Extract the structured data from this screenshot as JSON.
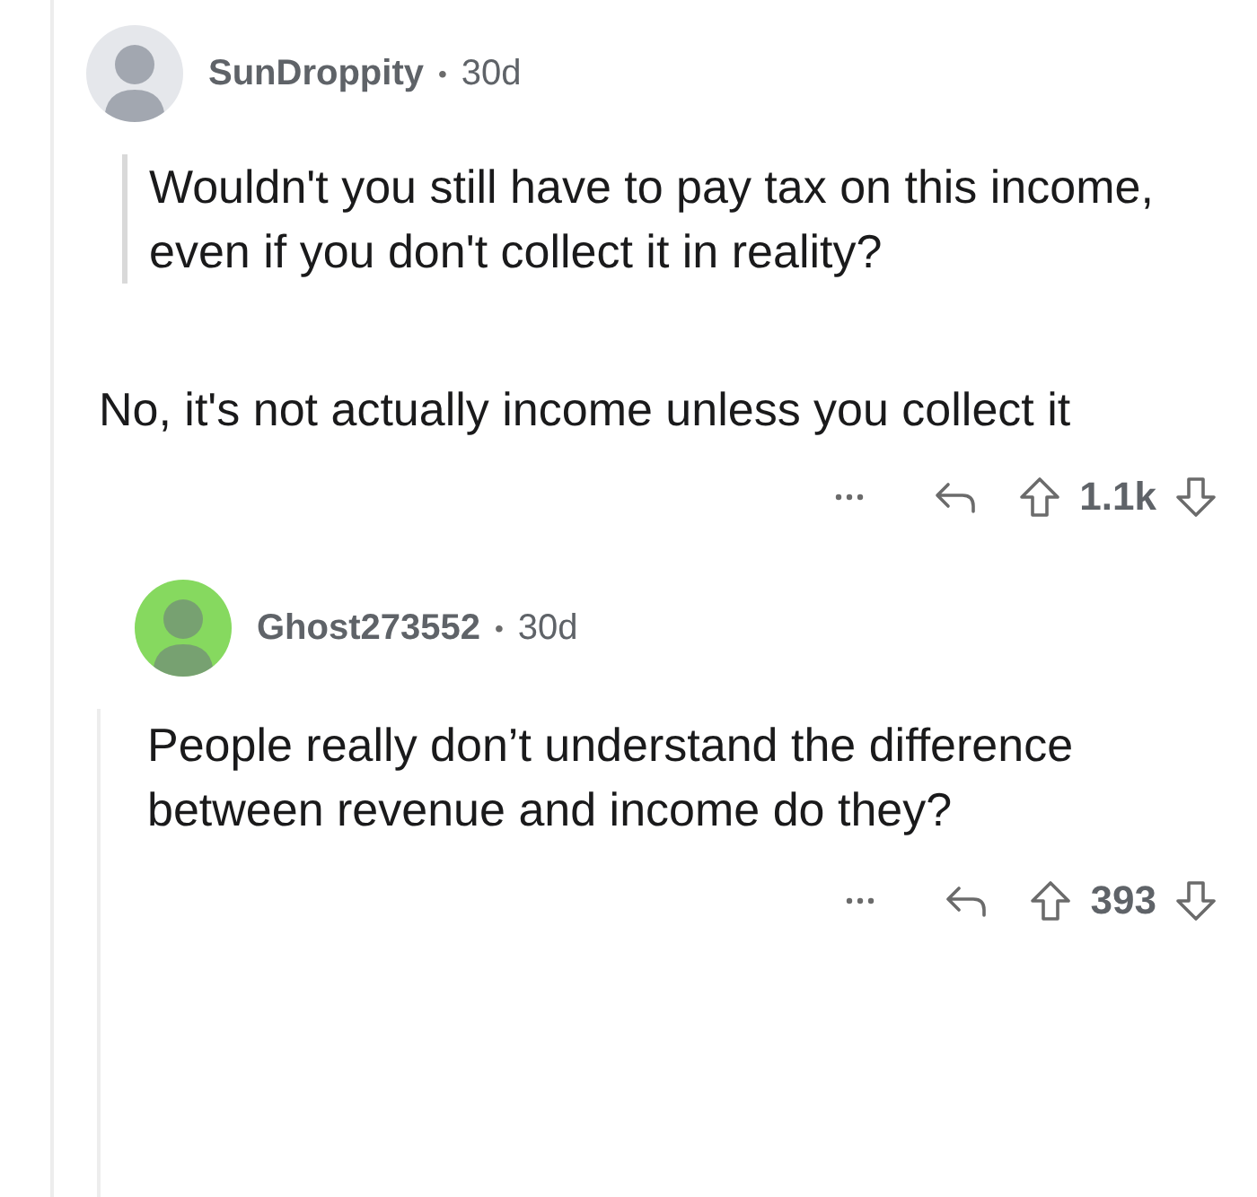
{
  "comments": [
    {
      "author": "SunDroppity",
      "separator": "•",
      "age": "30d",
      "color": "#e5e7eb",
      "quote": "Wouldn't you still have to pay tax on this income, even if you don't collect it in reality?",
      "body": "No, it's not actually income unless you collect it",
      "score": "1.1k",
      "children": [
        {
          "author": "Ghost273552",
          "separator": "•",
          "age": "30d",
          "color": "#86d95f",
          "body": "People really don’t understand the difference between revenue and income do they?",
          "score": "393"
        }
      ]
    }
  ]
}
